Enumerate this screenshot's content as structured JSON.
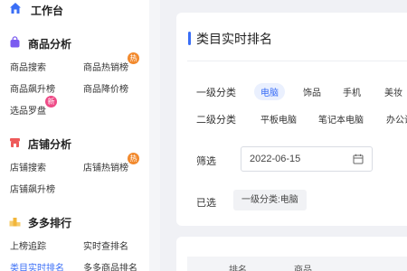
{
  "sidebar": {
    "workbench": "工作台",
    "sections": [
      {
        "title": "商品分析",
        "items": [
          "商品搜索",
          "商品热销榜",
          "商品飙升榜",
          "商品降价榜",
          "选品罗盘"
        ]
      },
      {
        "title": "店铺分析",
        "items": [
          "店铺搜索",
          "店铺热销榜",
          "店铺飙升榜"
        ]
      },
      {
        "title": "多多排行",
        "items": [
          "上榜追踪",
          "实时查排名",
          "类目实时排名",
          "多多商品排名"
        ]
      }
    ],
    "badges": {
      "hot": "热",
      "new": "新"
    }
  },
  "card": {
    "title": "类目实时排名",
    "level1": {
      "label": "一级分类",
      "options": [
        "电脑",
        "饰品",
        "手机",
        "美妆"
      ],
      "selected_index": 0
    },
    "level2": {
      "label": "二级分类",
      "options": [
        "平板电脑",
        "笔记本电脑",
        "办公设"
      ]
    },
    "filter": {
      "label": "筛选",
      "date": "2022-06-15"
    },
    "selected": {
      "label": "已选",
      "chip": "一级分类:电脑"
    }
  },
  "table": {
    "headers": [
      "排名",
      "商品"
    ]
  },
  "colors": {
    "accent": "#3a6ef6",
    "hot_badge": "#f28a2e",
    "new_badge": "#ee4a86"
  }
}
